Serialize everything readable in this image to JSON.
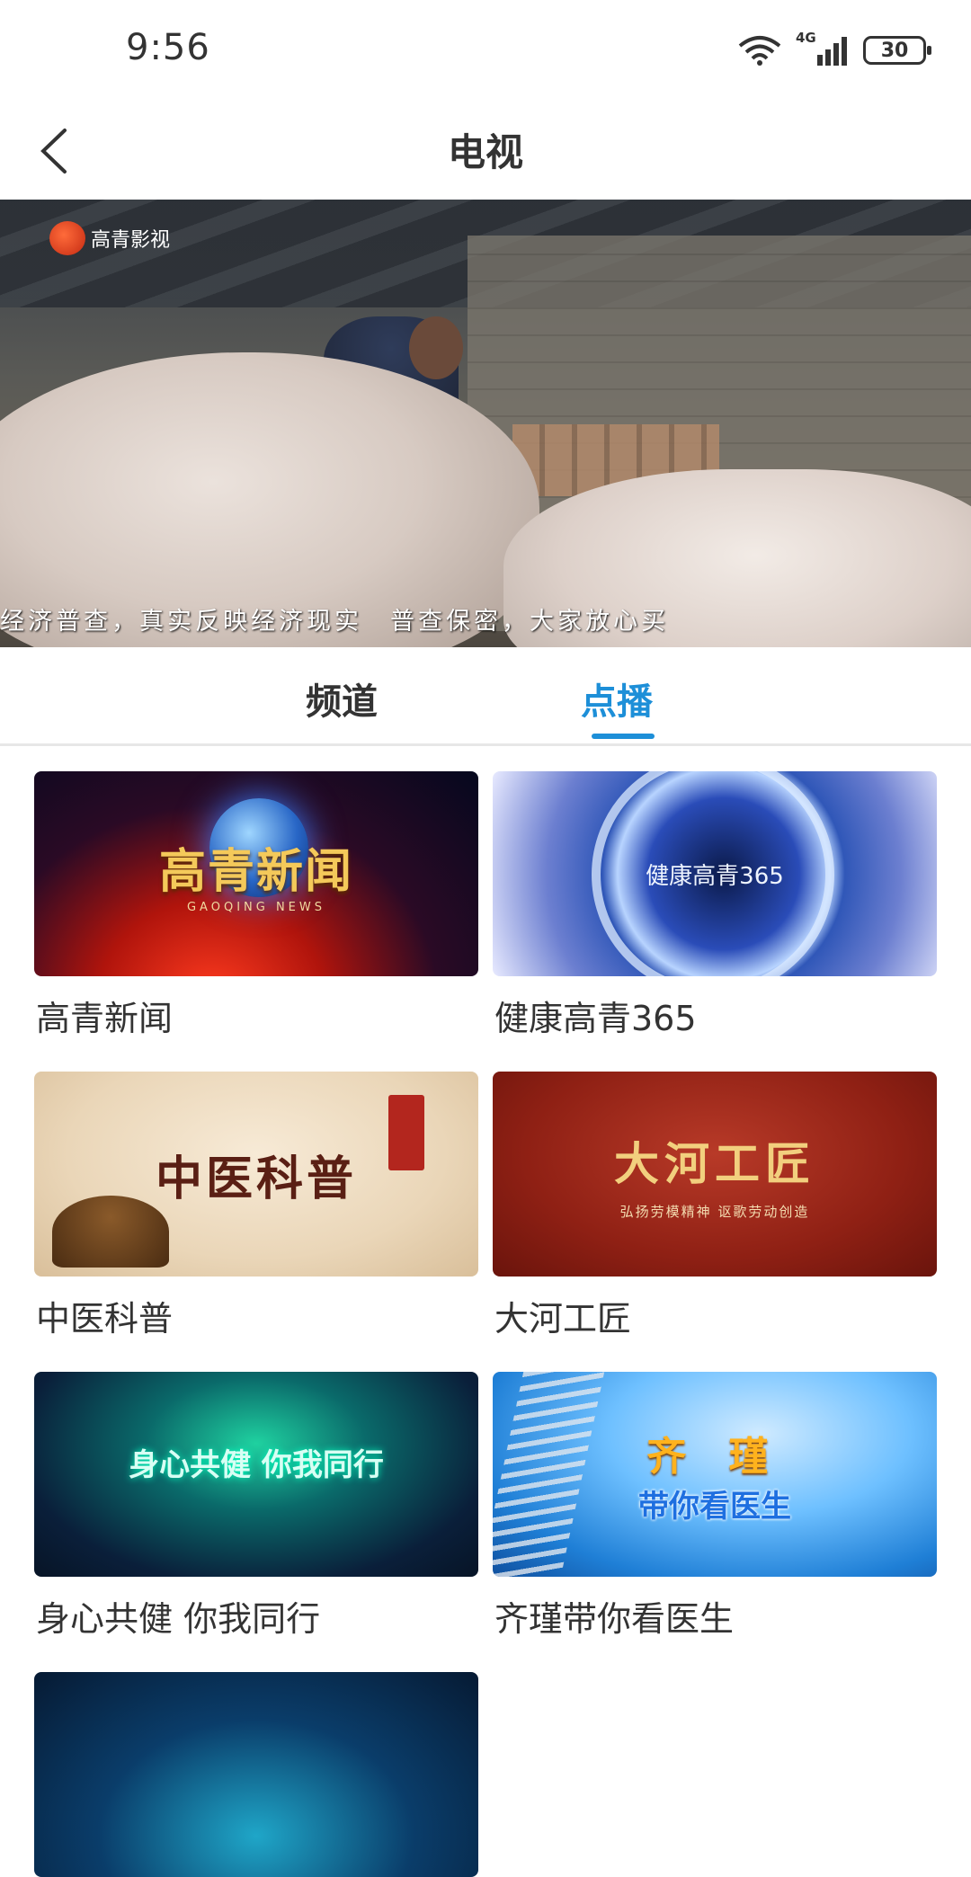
{
  "status_bar": {
    "time": "9:56",
    "network_label": "4G",
    "battery_level": "30"
  },
  "header": {
    "title": "电视",
    "back_icon": "chevron-left-icon"
  },
  "player": {
    "logo_text": "高青影视",
    "subtitle": "经济普查，真实反映经济现实　普查保密，大家放心买"
  },
  "tabs": {
    "items": [
      {
        "label": "频道",
        "active": false
      },
      {
        "label": "点播",
        "active": true
      }
    ],
    "active_color": "#1d8fd8"
  },
  "programs": [
    {
      "label": "高青新闻",
      "thumb_title": "高青新闻",
      "thumb_sub": "GAOQING NEWS"
    },
    {
      "label": "健康高青365",
      "thumb_title": "健康高青365"
    },
    {
      "label": "中医科普",
      "thumb_title": "中医科普"
    },
    {
      "label": "大河工匠",
      "thumb_title": "大河工匠",
      "thumb_sub": "弘扬劳模精神  讴歌劳动创造"
    },
    {
      "label": "身心共健  你我同行",
      "thumb_title": "身心共健 你我同行"
    },
    {
      "label": "齐瑾带你看医生",
      "thumb_title": "齐  瑾",
      "thumb_sub": "带你看医生"
    }
  ]
}
